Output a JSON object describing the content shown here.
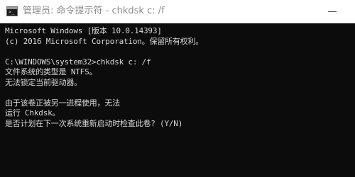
{
  "window": {
    "title": "管理员: 命令提示符 - chkdsk  c: /f",
    "icon": "cmd-console-icon",
    "title_color": "#8c8c8c",
    "background": "#0c0c0c",
    "text_color": "#d8d8d8"
  },
  "console": {
    "lines": [
      "Microsoft Windows [版本 10.0.14393]",
      "(c) 2016 Microsoft Corporation。保留所有权利。",
      "",
      "C:\\WINDOWS\\system32>chkdsk c: /f",
      "文件系统的类型是 NTFS。",
      "无法锁定当前驱动器。",
      "",
      "由于该卷正被另一进程使用，无法",
      "运行 Chkdsk。",
      "是否计划在下一次系统重新启动时检查此卷? (Y/N)"
    ]
  }
}
